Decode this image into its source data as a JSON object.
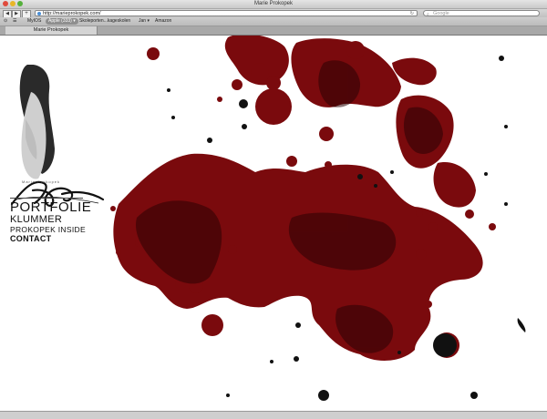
{
  "window": {
    "title": "Marie Prokopek"
  },
  "toolbar": {
    "url": "http://marieprokopek.com/",
    "search_placeholder": "Google",
    "back_label": "◀",
    "forward_label": "▶",
    "add_label": "+"
  },
  "bookmarks": [
    {
      "label": "MyIOS"
    },
    {
      "label": "Apple (333) ▾"
    },
    {
      "label": "Skoleporten...kageskolen"
    },
    {
      "label": "Jan ▾"
    },
    {
      "label": "Amazon"
    }
  ],
  "tab": {
    "label": "Marie Prokopek"
  },
  "site": {
    "logo_caption": "Marie Prokopek",
    "menu": {
      "portfolie": "PORTFOLIE",
      "klummer": "KLUMMER",
      "inside": "PROKOPEK INSIDE",
      "contact": "CONTACT"
    }
  },
  "colors": {
    "splash": "#7a0a0d",
    "splash_dark": "#2a0204",
    "ink": "#111111"
  }
}
